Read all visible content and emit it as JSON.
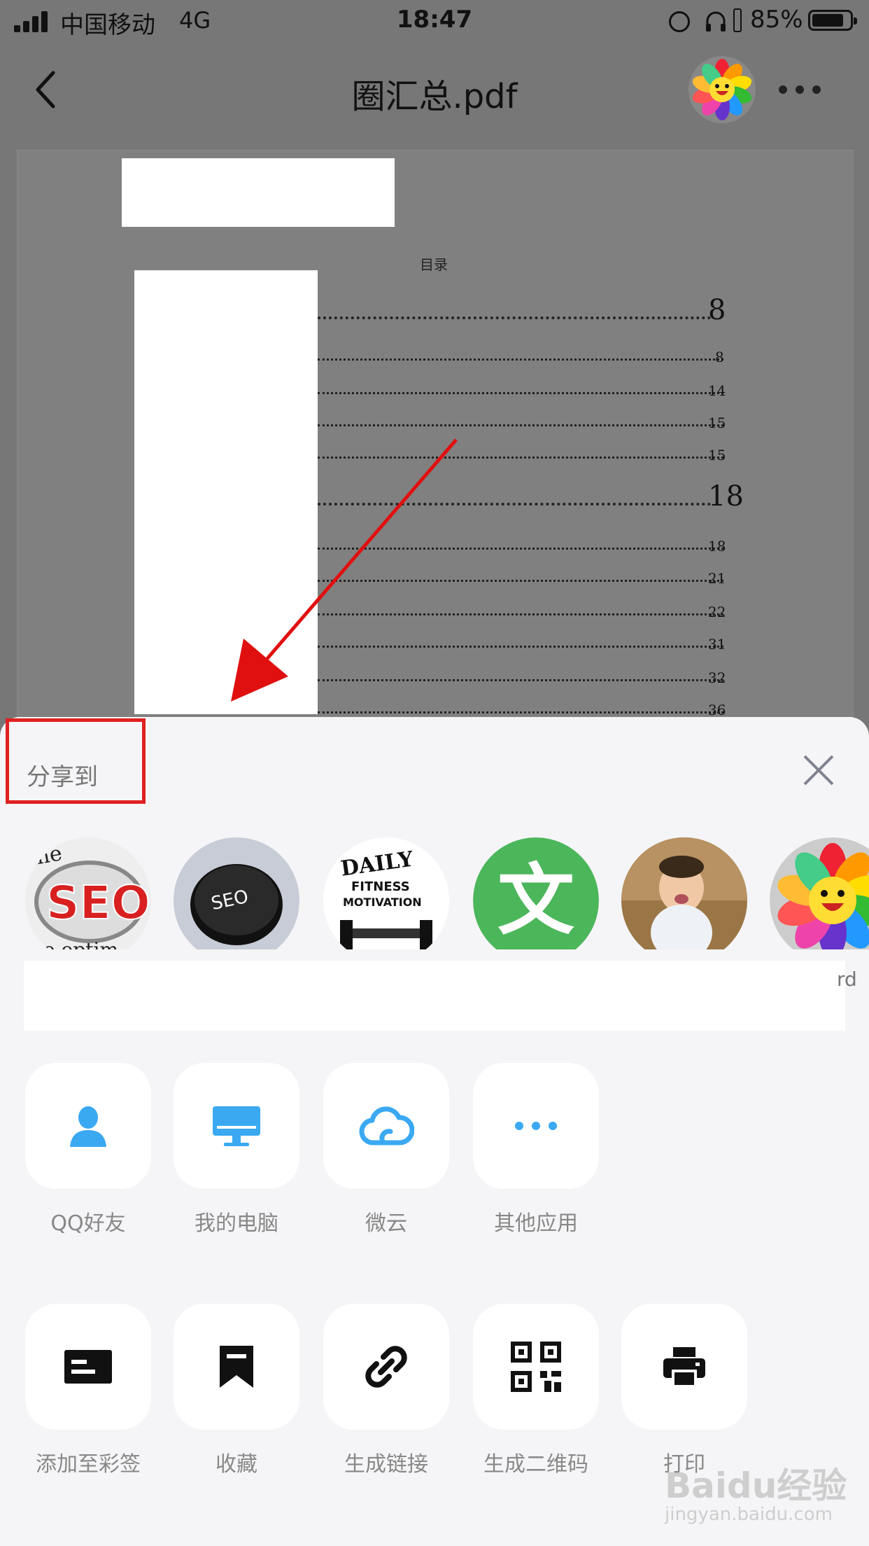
{
  "status_bar": {
    "carrier": "中国移动",
    "network": "4G",
    "time": "18:47",
    "battery_percent": "85%"
  },
  "nav": {
    "title": "圈汇总.pdf"
  },
  "document": {
    "toc_title": "目录",
    "toc_entries": [
      {
        "page": "8",
        "level": 1
      },
      {
        "page": "8",
        "level": 2
      },
      {
        "page": "14",
        "level": 2
      },
      {
        "page": "15",
        "level": 2
      },
      {
        "page": "15",
        "level": 2
      },
      {
        "page": "18",
        "level": 1
      },
      {
        "page": "18",
        "level": 2
      },
      {
        "page": "21",
        "level": 2
      },
      {
        "page": "22",
        "level": 2
      },
      {
        "page": "31",
        "level": 2
      },
      {
        "page": "32",
        "level": 2
      },
      {
        "page": "36",
        "level": 2
      }
    ]
  },
  "share_sheet": {
    "title": "分享到",
    "contacts_truncated_name": "rd",
    "row1": [
      {
        "label": "QQ好友",
        "icon": "contact-icon"
      },
      {
        "label": "我的电脑",
        "icon": "monitor-icon"
      },
      {
        "label": "微云",
        "icon": "cloud-icon"
      },
      {
        "label": "其他应用",
        "icon": "more-dots-icon"
      }
    ],
    "row2": [
      {
        "label": "添加至彩签",
        "icon": "label-card-icon"
      },
      {
        "label": "收藏",
        "icon": "bookmark-icon"
      },
      {
        "label": "生成链接",
        "icon": "link-icon"
      },
      {
        "label": "生成二维码",
        "icon": "qrcode-icon"
      },
      {
        "label": "打印",
        "icon": "printer-icon"
      }
    ]
  },
  "watermark": {
    "logo": "Baidu经验",
    "url": "jingyan.baidu.com"
  },
  "colors": {
    "accent_blue": "#3aa9f2",
    "highlight_red": "#e02020",
    "sheet_bg": "#f5f5f7"
  }
}
